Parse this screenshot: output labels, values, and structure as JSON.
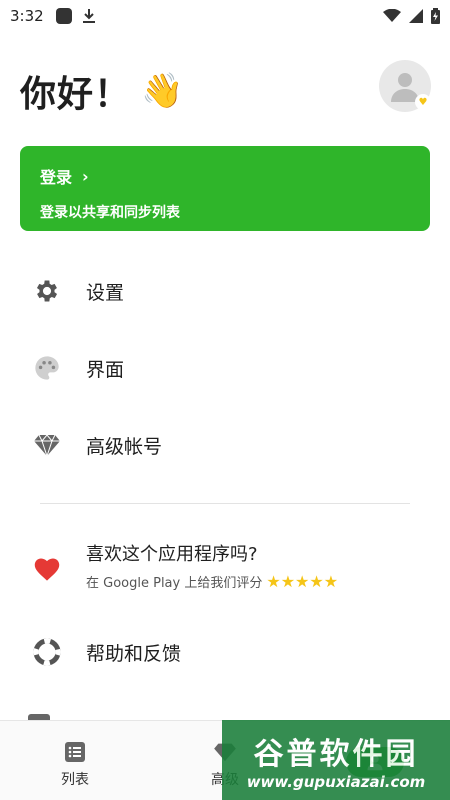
{
  "status_bar": {
    "time": "3:32"
  },
  "greeting": {
    "text": "你好！",
    "emoji": "👋"
  },
  "login_card": {
    "title": "登录",
    "subtitle": "登录以共享和同步列表"
  },
  "menu": {
    "settings": "设置",
    "interface": "界面",
    "premium": "高级帐号",
    "help": "帮助和反馈"
  },
  "rate": {
    "title": "喜欢这个应用程序吗?",
    "subtitle": "在 Google Play 上给我们评分",
    "stars": "★★★★★"
  },
  "bottom_nav": {
    "tabs": [
      {
        "label": "列表",
        "icon": "list-icon"
      },
      {
        "label": "高级",
        "icon": "diamond-icon"
      },
      {
        "label": "",
        "icon": "active-tab-icon"
      }
    ]
  },
  "watermark": {
    "title": "谷普软件园",
    "url": "www.gupuxiazai.com"
  },
  "colors": {
    "accent": "#2fb52a",
    "heart": "#e53935",
    "star": "#f5c518"
  }
}
